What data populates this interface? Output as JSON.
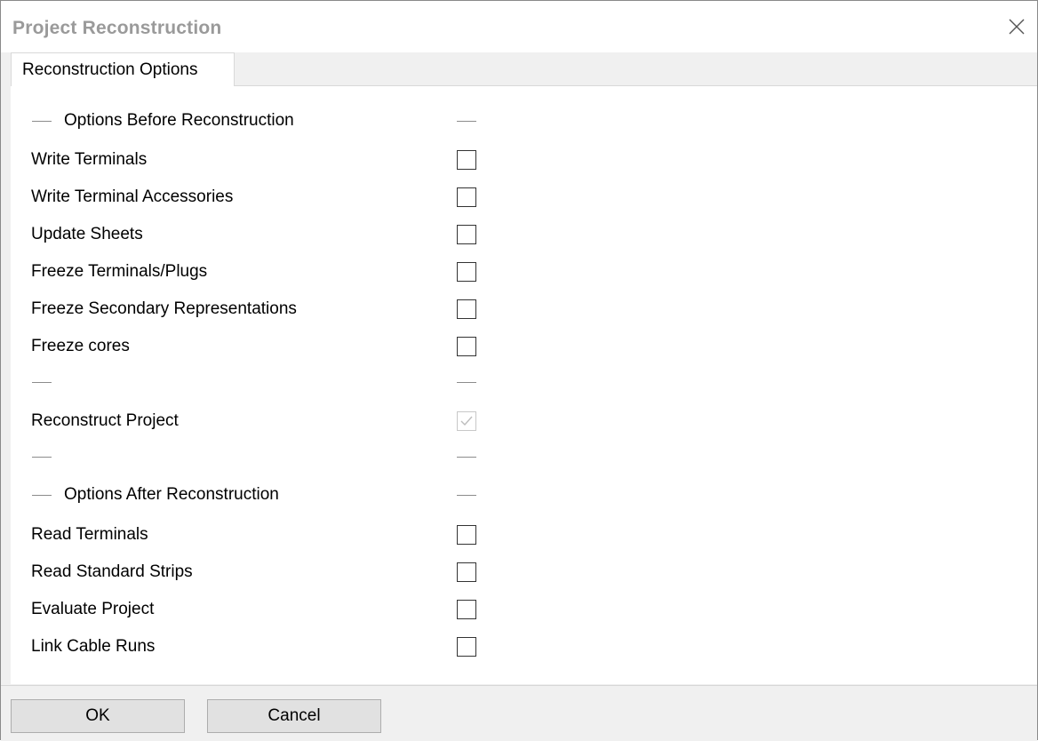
{
  "window": {
    "title": "Project Reconstruction",
    "close_icon": "close-icon"
  },
  "tabs": [
    {
      "label": "Reconstruction Options",
      "active": true
    }
  ],
  "sections": {
    "before": "Options Before Reconstruction",
    "after": "Options After Reconstruction"
  },
  "options_before": [
    {
      "label": "Write Terminals",
      "checked": false
    },
    {
      "label": "Write Terminal Accessories",
      "checked": false
    },
    {
      "label": "Update Sheets",
      "checked": false
    },
    {
      "label": "Freeze Terminals/Plugs",
      "checked": false
    },
    {
      "label": "Freeze Secondary Representations",
      "checked": false
    },
    {
      "label": "Freeze cores",
      "checked": false
    }
  ],
  "reconstruct": {
    "label": "Reconstruct Project",
    "checked": true,
    "enabled": false
  },
  "options_after": [
    {
      "label": "Read Terminals",
      "checked": false
    },
    {
      "label": "Read Standard Strips",
      "checked": false
    },
    {
      "label": "Evaluate Project",
      "checked": false
    },
    {
      "label": "Link Cable Runs",
      "checked": false
    }
  ],
  "footer": {
    "ok_label": "OK",
    "cancel_label": "Cancel"
  },
  "colors": {
    "title_text": "#9a9a9a",
    "panel_bg": "#ffffff",
    "dialog_bg": "#f0f0f0",
    "button_bg": "#e1e1e1",
    "disabled_check": "#c8c8c8"
  }
}
